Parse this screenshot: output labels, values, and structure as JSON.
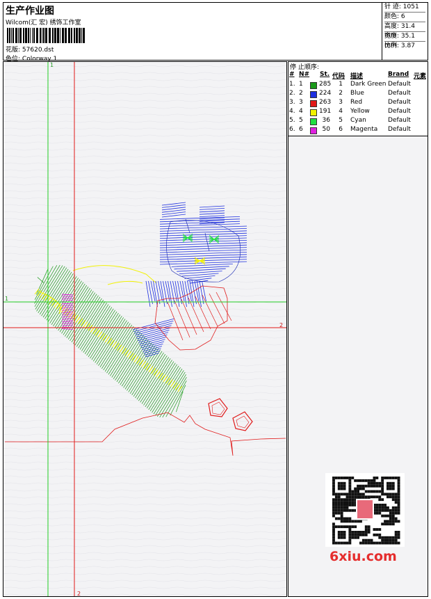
{
  "header": {
    "title": "生产作业图",
    "company": "Wilcom(汇 宏) 绣饰工作室",
    "file_label": "花版:",
    "file_value": "57620.dst",
    "colorway_label": "色位:",
    "colorway_value": "Colorway 1"
  },
  "stats": [
    {
      "label": "针 迹:",
      "value": "1051"
    },
    {
      "label": "颜色:",
      "value": "6"
    },
    {
      "label": "高度:",
      "value": "31.4 mm"
    },
    {
      "label": "宽度:",
      "value": "35.1 mm"
    },
    {
      "label": "比例:",
      "value": "3.87"
    }
  ],
  "legend": {
    "title": "停 止顺序:",
    "columns": {
      "order": "#",
      "needle": "N#",
      "stitches": "St.",
      "code": "代码",
      "desc": "描述",
      "brand": "Brand",
      "element": "元素"
    },
    "rows": [
      {
        "order": "1.",
        "needle": "1",
        "color": "#1a9a1a",
        "stitches": "285",
        "code": "1",
        "desc": "Dark Green",
        "brand": "Default"
      },
      {
        "order": "2.",
        "needle": "2",
        "color": "#1d2fe0",
        "stitches": "224",
        "code": "2",
        "desc": "Blue",
        "brand": "Default"
      },
      {
        "order": "3.",
        "needle": "3",
        "color": "#e01818",
        "stitches": "263",
        "code": "3",
        "desc": "Red",
        "brand": "Default"
      },
      {
        "order": "4.",
        "needle": "4",
        "color": "#f2f200",
        "stitches": "191",
        "code": "4",
        "desc": "Yellow",
        "brand": "Default"
      },
      {
        "order": "5.",
        "needle": "5",
        "color": "#20e040",
        "stitches": "36",
        "code": "5",
        "desc": "Cyan",
        "brand": "Default"
      },
      {
        "order": "6.",
        "needle": "6",
        "color": "#e020e0",
        "stitches": "50",
        "code": "6",
        "desc": "Magenta",
        "brand": "Default"
      }
    ]
  },
  "guides": {
    "green_vertical": "1",
    "green_horizontal": "1",
    "red_vertical": "2",
    "red_horizontal": "2"
  },
  "watermark": "6xiu.com"
}
